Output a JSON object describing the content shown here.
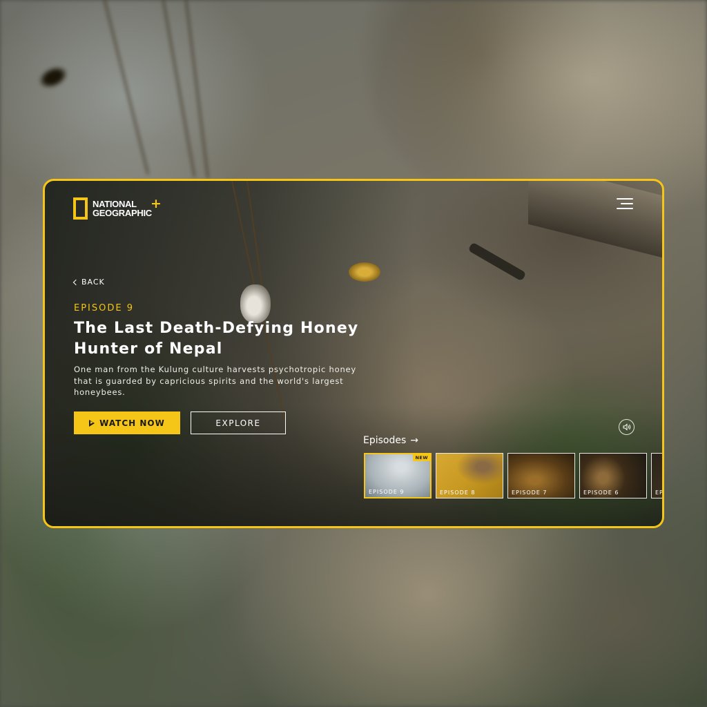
{
  "brand": {
    "logo_line1": "NATIONAL",
    "logo_line2": "GEOGRAPHIC",
    "logo_plus": "+"
  },
  "nav": {
    "back_label": "BACK",
    "menu_icon": "hamburger-menu-icon"
  },
  "hero": {
    "episode_label": "EPISODE 9",
    "title": "The Last Death-Defying Honey Hunter of Nepal",
    "description": "One man from the Kulung culture harvests psychotropic honey that is guarded by capricious spirits and the world's largest honeybees.",
    "watch_label": "WATCH NOW",
    "explore_label": "EXPLORE"
  },
  "episodes": {
    "heading": "Episodes",
    "arrow": "→",
    "items": [
      {
        "label": "EPISODE 9",
        "badge": "NEW",
        "active": true
      },
      {
        "label": "EPISODE 8"
      },
      {
        "label": "EPISODE 7"
      },
      {
        "label": "EPISODE 6"
      },
      {
        "label": "EPI"
      }
    ]
  },
  "colors": {
    "accent": "#f5c518"
  }
}
